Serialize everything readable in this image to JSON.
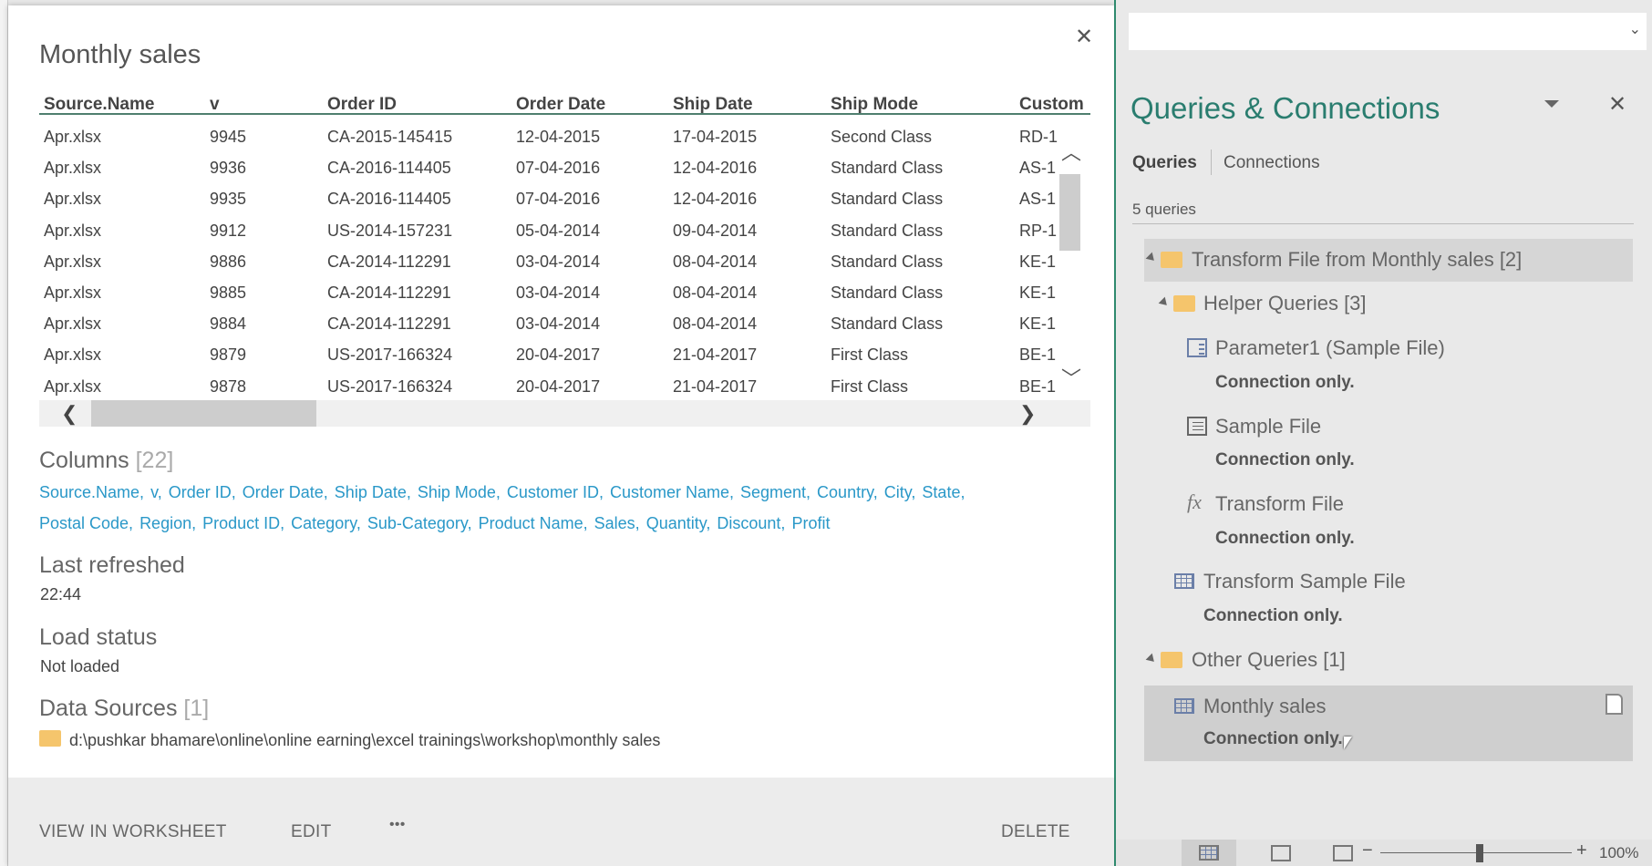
{
  "popup": {
    "title": "Monthly sales",
    "columns_header": [
      "Source.Name",
      "v",
      "Order ID",
      "Order Date",
      "Ship Date",
      "Ship Mode",
      "Custom"
    ],
    "rows": [
      [
        "Apr.xlsx",
        "9945",
        "CA-2015-145415",
        "12-04-2015",
        "17-04-2015",
        "Second Class",
        "RD-1"
      ],
      [
        "Apr.xlsx",
        "9936",
        "CA-2016-114405",
        "07-04-2016",
        "12-04-2016",
        "Standard Class",
        "AS-1"
      ],
      [
        "Apr.xlsx",
        "9935",
        "CA-2016-114405",
        "07-04-2016",
        "12-04-2016",
        "Standard Class",
        "AS-1"
      ],
      [
        "Apr.xlsx",
        "9912",
        "US-2014-157231",
        "05-04-2014",
        "09-04-2014",
        "Standard Class",
        "RP-1"
      ],
      [
        "Apr.xlsx",
        "9886",
        "CA-2014-112291",
        "03-04-2014",
        "08-04-2014",
        "Standard Class",
        "KE-1"
      ],
      [
        "Apr.xlsx",
        "9885",
        "CA-2014-112291",
        "03-04-2014",
        "08-04-2014",
        "Standard Class",
        "KE-1"
      ],
      [
        "Apr.xlsx",
        "9884",
        "CA-2014-112291",
        "03-04-2014",
        "08-04-2014",
        "Standard Class",
        "KE-1"
      ],
      [
        "Apr.xlsx",
        "9879",
        "US-2017-166324",
        "20-04-2017",
        "21-04-2017",
        "First Class",
        "BE-1"
      ],
      [
        "Apr.xlsx",
        "9878",
        "US-2017-166324",
        "20-04-2017",
        "21-04-2017",
        "First Class",
        "BE-1"
      ]
    ],
    "columns_label": "Columns",
    "columns_count": "[22]",
    "column_links_line1": [
      "Source.Name,",
      "v,",
      "Order ID,",
      "Order Date,",
      "Ship Date,",
      "Ship Mode,",
      "Customer ID,",
      "Customer Name,",
      "Segment,",
      "Country,",
      "City,",
      "State,"
    ],
    "column_links_line2": [
      "Postal Code,",
      "Region,",
      "Product ID,",
      "Category,",
      "Sub-Category,",
      "Product Name,",
      "Sales,",
      "Quantity,",
      "Discount,",
      "Profit"
    ],
    "last_refreshed_label": "Last refreshed",
    "last_refreshed": "22:44",
    "load_status_label": "Load status",
    "load_status": "Not loaded",
    "data_sources_label": "Data Sources",
    "data_sources_count": "[1]",
    "data_source_path": "d:\\pushkar bhamare\\online\\online earning\\excel trainings\\workshop\\monthly sales",
    "footer": {
      "view": "VIEW IN WORKSHEET",
      "edit": "EDIT",
      "more": "•••",
      "delete": "DELETE"
    },
    "close": "✕"
  },
  "panel": {
    "title": "Queries & Connections",
    "close": "✕",
    "tabs": [
      "Queries",
      "Connections"
    ],
    "count": "5 queries",
    "groups": {
      "g1": "Transform File from Monthly sales [2]",
      "g2": "Helper Queries [3]",
      "g3": "Other Queries [1]"
    },
    "items": [
      {
        "name": "Parameter1 (Sample File)",
        "status": "Connection only.",
        "icon": "parameter-icon"
      },
      {
        "name": "Sample File",
        "status": "Connection only.",
        "icon": "document-icon"
      },
      {
        "name": "Transform File",
        "status": "Connection only.",
        "icon": "function-icon"
      },
      {
        "name": "Transform Sample File",
        "status": "Connection only.",
        "icon": "table-icon"
      },
      {
        "name": "Monthly sales",
        "status": "Connection only.",
        "icon": "table-icon"
      }
    ],
    "fx": "fx"
  },
  "statusbar": {
    "zoom": "100%",
    "minus": "−",
    "plus": "+",
    "zoom_level_percent": 100
  },
  "colors": {
    "accent": "#2a7d6f",
    "link": "#2a98c8",
    "folder": "#f5c56c"
  }
}
